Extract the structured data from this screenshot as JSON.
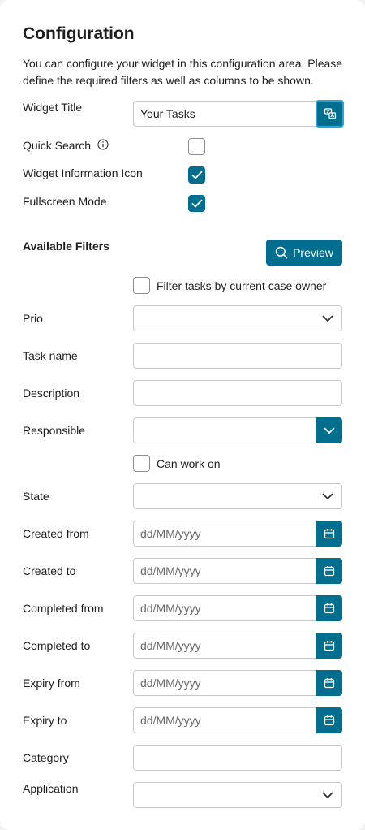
{
  "header": {
    "title": "Configuration",
    "description": "You can configure your widget in this configuration area. Please define the required filters as well as columns to be shown."
  },
  "settings": {
    "widget_title_label": "Widget Title",
    "widget_title_value": "Your Tasks",
    "quick_search_label": "Quick Search",
    "quick_search_checked": false,
    "info_icon_label": "Widget Information Icon",
    "info_icon_checked": true,
    "fullscreen_label": "Fullscreen Mode",
    "fullscreen_checked": true
  },
  "filters": {
    "section_title": "Available Filters",
    "preview_label": "Preview",
    "case_owner_label": "Filter tasks by current case owner",
    "case_owner_checked": false,
    "prio_label": "Prio",
    "task_name_label": "Task name",
    "description_label": "Description",
    "responsible_label": "Responsible",
    "can_work_on_label": "Can work on",
    "can_work_on_checked": false,
    "state_label": "State",
    "created_from_label": "Created from",
    "created_to_label": "Created to",
    "completed_from_label": "Completed from",
    "completed_to_label": "Completed to",
    "expiry_from_label": "Expiry from",
    "expiry_to_label": "Expiry to",
    "category_label": "Category",
    "application_label": "Application",
    "date_placeholder": "dd/MM/yyyy"
  },
  "colors": {
    "primary": "#006e8f",
    "focus_ring": "#2aa3d6",
    "border": "#c8c8c8"
  },
  "icons": {
    "info": "info-icon",
    "translate": "translate-icon",
    "search": "search-icon",
    "calendar": "calendar-icon",
    "chevron": "chevron-down-icon",
    "check": "check-icon"
  }
}
